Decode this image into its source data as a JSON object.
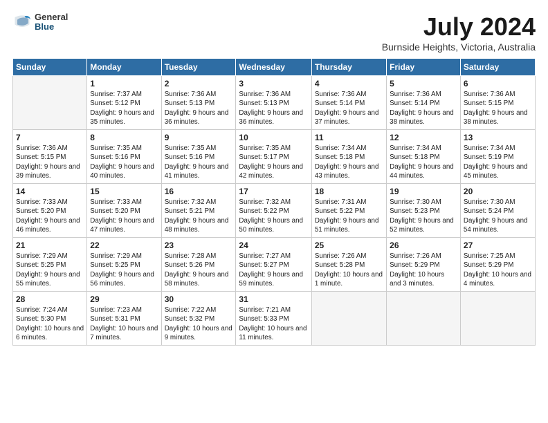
{
  "logo": {
    "general": "General",
    "blue": "Blue"
  },
  "header": {
    "title": "July 2024",
    "subtitle": "Burnside Heights, Victoria, Australia"
  },
  "weekdays": [
    "Sunday",
    "Monday",
    "Tuesday",
    "Wednesday",
    "Thursday",
    "Friday",
    "Saturday"
  ],
  "weeks": [
    [
      {
        "day": "",
        "empty": true
      },
      {
        "day": "1",
        "sunrise": "7:37 AM",
        "sunset": "5:12 PM",
        "daylight": "9 hours and 35 minutes."
      },
      {
        "day": "2",
        "sunrise": "7:36 AM",
        "sunset": "5:13 PM",
        "daylight": "9 hours and 36 minutes."
      },
      {
        "day": "3",
        "sunrise": "7:36 AM",
        "sunset": "5:13 PM",
        "daylight": "9 hours and 36 minutes."
      },
      {
        "day": "4",
        "sunrise": "7:36 AM",
        "sunset": "5:14 PM",
        "daylight": "9 hours and 37 minutes."
      },
      {
        "day": "5",
        "sunrise": "7:36 AM",
        "sunset": "5:14 PM",
        "daylight": "9 hours and 38 minutes."
      },
      {
        "day": "6",
        "sunrise": "7:36 AM",
        "sunset": "5:15 PM",
        "daylight": "9 hours and 38 minutes."
      }
    ],
    [
      {
        "day": "7",
        "sunrise": "7:36 AM",
        "sunset": "5:15 PM",
        "daylight": "9 hours and 39 minutes."
      },
      {
        "day": "8",
        "sunrise": "7:35 AM",
        "sunset": "5:16 PM",
        "daylight": "9 hours and 40 minutes."
      },
      {
        "day": "9",
        "sunrise": "7:35 AM",
        "sunset": "5:16 PM",
        "daylight": "9 hours and 41 minutes."
      },
      {
        "day": "10",
        "sunrise": "7:35 AM",
        "sunset": "5:17 PM",
        "daylight": "9 hours and 42 minutes."
      },
      {
        "day": "11",
        "sunrise": "7:34 AM",
        "sunset": "5:18 PM",
        "daylight": "9 hours and 43 minutes."
      },
      {
        "day": "12",
        "sunrise": "7:34 AM",
        "sunset": "5:18 PM",
        "daylight": "9 hours and 44 minutes."
      },
      {
        "day": "13",
        "sunrise": "7:34 AM",
        "sunset": "5:19 PM",
        "daylight": "9 hours and 45 minutes."
      }
    ],
    [
      {
        "day": "14",
        "sunrise": "7:33 AM",
        "sunset": "5:20 PM",
        "daylight": "9 hours and 46 minutes."
      },
      {
        "day": "15",
        "sunrise": "7:33 AM",
        "sunset": "5:20 PM",
        "daylight": "9 hours and 47 minutes."
      },
      {
        "day": "16",
        "sunrise": "7:32 AM",
        "sunset": "5:21 PM",
        "daylight": "9 hours and 48 minutes."
      },
      {
        "day": "17",
        "sunrise": "7:32 AM",
        "sunset": "5:22 PM",
        "daylight": "9 hours and 50 minutes."
      },
      {
        "day": "18",
        "sunrise": "7:31 AM",
        "sunset": "5:22 PM",
        "daylight": "9 hours and 51 minutes."
      },
      {
        "day": "19",
        "sunrise": "7:30 AM",
        "sunset": "5:23 PM",
        "daylight": "9 hours and 52 minutes."
      },
      {
        "day": "20",
        "sunrise": "7:30 AM",
        "sunset": "5:24 PM",
        "daylight": "9 hours and 54 minutes."
      }
    ],
    [
      {
        "day": "21",
        "sunrise": "7:29 AM",
        "sunset": "5:25 PM",
        "daylight": "9 hours and 55 minutes."
      },
      {
        "day": "22",
        "sunrise": "7:29 AM",
        "sunset": "5:25 PM",
        "daylight": "9 hours and 56 minutes."
      },
      {
        "day": "23",
        "sunrise": "7:28 AM",
        "sunset": "5:26 PM",
        "daylight": "9 hours and 58 minutes."
      },
      {
        "day": "24",
        "sunrise": "7:27 AM",
        "sunset": "5:27 PM",
        "daylight": "9 hours and 59 minutes."
      },
      {
        "day": "25",
        "sunrise": "7:26 AM",
        "sunset": "5:28 PM",
        "daylight": "10 hours and 1 minute."
      },
      {
        "day": "26",
        "sunrise": "7:26 AM",
        "sunset": "5:29 PM",
        "daylight": "10 hours and 3 minutes."
      },
      {
        "day": "27",
        "sunrise": "7:25 AM",
        "sunset": "5:29 PM",
        "daylight": "10 hours and 4 minutes."
      }
    ],
    [
      {
        "day": "28",
        "sunrise": "7:24 AM",
        "sunset": "5:30 PM",
        "daylight": "10 hours and 6 minutes."
      },
      {
        "day": "29",
        "sunrise": "7:23 AM",
        "sunset": "5:31 PM",
        "daylight": "10 hours and 7 minutes."
      },
      {
        "day": "30",
        "sunrise": "7:22 AM",
        "sunset": "5:32 PM",
        "daylight": "10 hours and 9 minutes."
      },
      {
        "day": "31",
        "sunrise": "7:21 AM",
        "sunset": "5:33 PM",
        "daylight": "10 hours and 11 minutes."
      },
      {
        "day": "",
        "empty": true
      },
      {
        "day": "",
        "empty": true
      },
      {
        "day": "",
        "empty": true
      }
    ]
  ]
}
